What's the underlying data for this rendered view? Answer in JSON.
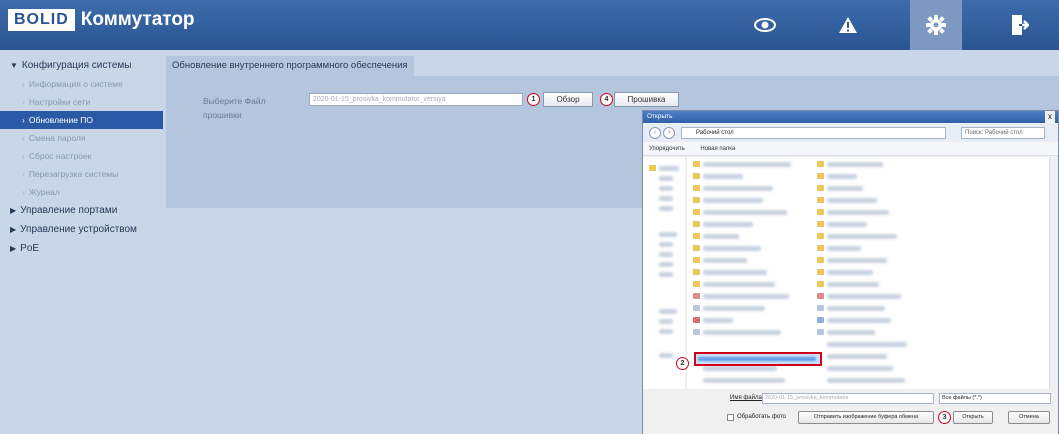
{
  "app": {
    "logo": "BOLID",
    "title": "Коммутатор"
  },
  "header_icons": [
    "eye-icon",
    "warning-icon",
    "gear-icon",
    "logout-icon"
  ],
  "sidebar": {
    "groups": [
      {
        "label": "Конфигурация системы",
        "expanded": true
      },
      {
        "label": "Управление портами",
        "expanded": false
      },
      {
        "label": "Управление устройством",
        "expanded": false
      },
      {
        "label": "PoE",
        "expanded": false
      }
    ],
    "items": [
      {
        "label": "Информация о системе"
      },
      {
        "label": "Настройки сети"
      },
      {
        "label": "Обновление ПО",
        "active": true
      },
      {
        "label": "Смена пароля"
      },
      {
        "label": "Сброс настроек"
      },
      {
        "label": "Перезагрузка системы"
      },
      {
        "label": "Журнал"
      }
    ]
  },
  "main": {
    "tab_title": "Обновление внутреннего программного обеспечения",
    "file_label": "Выберите Файл прошивки",
    "file_value": "2020-01-15_prosivka_kommutator_versiya",
    "browse_label": "Обзор",
    "flash_label": "Прошивка"
  },
  "badges": {
    "b1": "1",
    "b2": "2",
    "b3": "3",
    "b4": "4"
  },
  "dialog": {
    "title": "Открыть",
    "close": "x",
    "address": "Рабочий стол",
    "search_placeholder": "Поиск: Рабочий стол",
    "organize": "Упорядочить",
    "new_folder": "Новая папка",
    "filename_label": "Имя файла:",
    "filename_value": "2020-01-15_prosivka_kommutator",
    "filter_value": "Все файлы (*.*)",
    "process_photo": "Обработать фото",
    "clipboard_button": "Отправить изображение буфера обмена",
    "open_button": "Открыть",
    "cancel_button": "Отмена"
  },
  "colors": {
    "header": "#2b5492",
    "accent": "#2a59a5",
    "badge": "#d0021b",
    "bg": "#c8d6e8"
  }
}
